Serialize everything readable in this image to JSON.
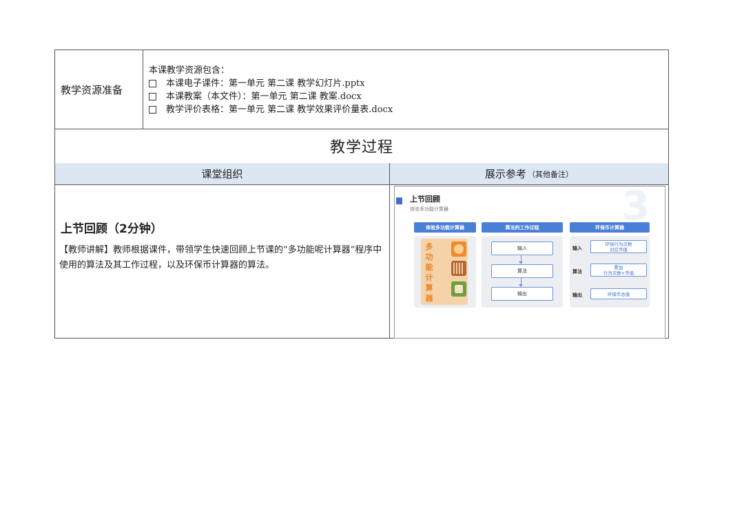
{
  "resources": {
    "label": "教学资源准备",
    "intro": "本课教学资源包含：",
    "items": [
      "本课电子课件：第一单元 第二课 教学幻灯片.pptx",
      "本课教案（本文件）：第一单元 第二课 教案.docx",
      "教学评价表格：第一单元 第二课 教学效果评价量表.docx"
    ]
  },
  "process_title": "教学过程",
  "headers": {
    "left": "课堂组织",
    "right": "展示参考",
    "right_sub": "（其他备注）"
  },
  "review": {
    "title": "上节回顾（2分钟）",
    "text": "【教师讲解】教师根据课件，带领学生快速回顾上节课的“多功能呢计算器”程序中使用的算法及其工作过程，以及环保币计算器的算法。"
  },
  "slide": {
    "title": "上节回顾",
    "subtitle": "体验多功能计算器",
    "number": "3",
    "col1_head": "体验多功能计算器",
    "col1_chars": [
      "多",
      "功",
      "能",
      "计",
      "算",
      "器"
    ],
    "col2_head": "算法的工作过程",
    "col2_flow": [
      "输入",
      "算法",
      "输出"
    ],
    "col3_head": "环保币计算器",
    "col3_labels": [
      "输入",
      "算法",
      "输出"
    ],
    "col3_boxes": [
      "环保行为次数\n对应币值",
      "累加\n行为次数×币值",
      "环保币总值"
    ],
    "accent_color": "#4a7fd8",
    "card_color": "#f6d2a8"
  }
}
